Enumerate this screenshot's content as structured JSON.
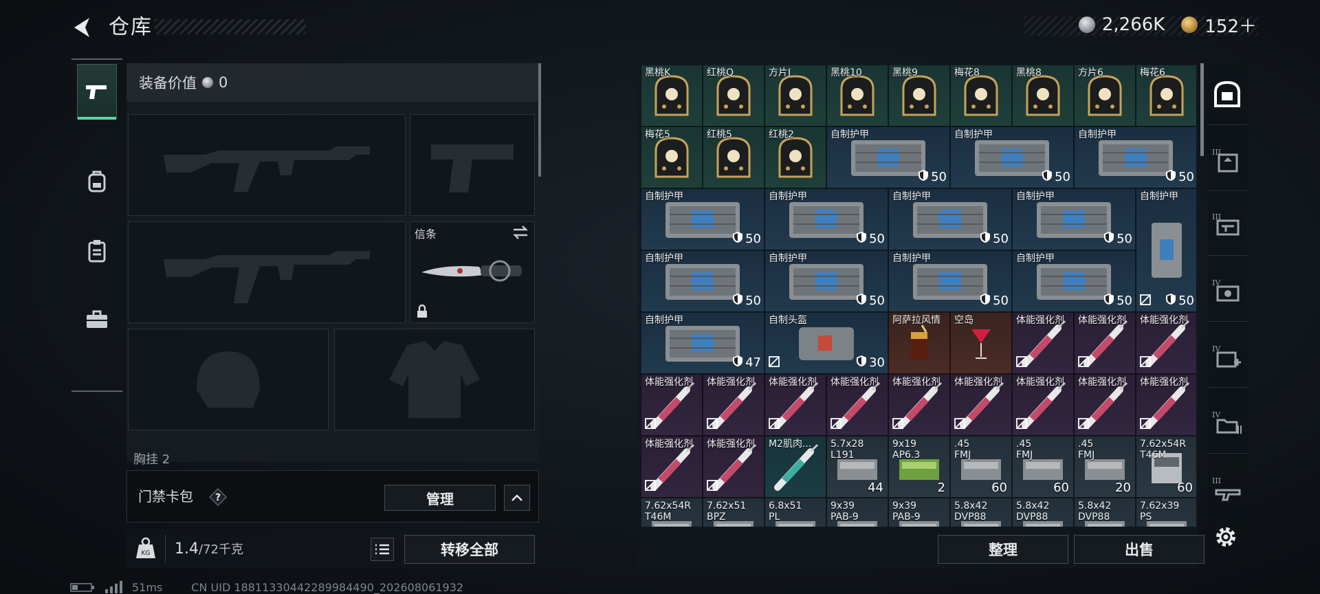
{
  "header": {
    "title": "仓库",
    "currency": [
      {
        "icon": "silver-coin-icon",
        "value": "2,266K"
      },
      {
        "icon": "gold-coin-icon",
        "value": "152＋"
      }
    ]
  },
  "left_tabs": [
    {
      "icon": "pistol-icon",
      "active": true
    },
    {
      "icon": "backpack-icon",
      "active": false
    },
    {
      "icon": "clipboard-icon",
      "active": false
    },
    {
      "icon": "briefcase-icon",
      "active": false
    }
  ],
  "equipment": {
    "label": "装备价值",
    "value": "0",
    "knife_slot_label": "信条",
    "chest_label": "胸挂",
    "chest_value": "2"
  },
  "access_card": {
    "label": "门禁卡包",
    "help": "?",
    "manage": "管理"
  },
  "weight": {
    "current": "1.4",
    "max": "/72千克"
  },
  "buttons": {
    "transfer_all": "转移全部",
    "sort": "整理",
    "sell": "出售"
  },
  "status": {
    "ping": "51ms",
    "uid": "CN UID 18811330442289984490_202608061932"
  },
  "inventory": [
    {
      "row": 0,
      "col": 0,
      "name": "黑桃K",
      "type": "card"
    },
    {
      "row": 0,
      "col": 1,
      "name": "红桃Q",
      "type": "card"
    },
    {
      "row": 0,
      "col": 2,
      "name": "方片J",
      "type": "card"
    },
    {
      "row": 0,
      "col": 3,
      "name": "黑桃10",
      "type": "card"
    },
    {
      "row": 0,
      "col": 4,
      "name": "黑桃9",
      "type": "card"
    },
    {
      "row": 0,
      "col": 5,
      "name": "梅花8",
      "type": "card"
    },
    {
      "row": 0,
      "col": 6,
      "name": "黑桃8",
      "type": "card"
    },
    {
      "row": 0,
      "col": 7,
      "name": "方片6",
      "type": "card"
    },
    {
      "row": 0,
      "col": 8,
      "name": "梅花6",
      "type": "card"
    },
    {
      "row": 1,
      "col": 0,
      "name": "梅花5",
      "type": "card"
    },
    {
      "row": 1,
      "col": 1,
      "name": "红桃5",
      "type": "card"
    },
    {
      "row": 1,
      "col": 2,
      "name": "红桃2",
      "type": "card"
    },
    {
      "row": 1,
      "col": 3,
      "w": 2,
      "name": "自制护甲",
      "type": "armor",
      "dur": "50"
    },
    {
      "row": 1,
      "col": 5,
      "w": 2,
      "name": "自制护甲",
      "type": "armor",
      "dur": "50"
    },
    {
      "row": 1,
      "col": 7,
      "w": 2,
      "name": "自制护甲",
      "type": "armor",
      "dur": "50"
    },
    {
      "row": 2,
      "col": 0,
      "w": 2,
      "name": "自制护甲",
      "type": "armor",
      "dur": "50"
    },
    {
      "row": 2,
      "col": 2,
      "w": 2,
      "name": "自制护甲",
      "type": "armor",
      "dur": "50"
    },
    {
      "row": 2,
      "col": 4,
      "w": 2,
      "name": "自制护甲",
      "type": "armor",
      "dur": "50"
    },
    {
      "row": 2,
      "col": 6,
      "w": 2,
      "name": "自制护甲",
      "type": "armor",
      "dur": "50"
    },
    {
      "row": 2,
      "col": 8,
      "h": 2,
      "name": "自制护甲",
      "type": "armor-v",
      "dur": "50",
      "unlocked": true
    },
    {
      "row": 3,
      "col": 0,
      "w": 2,
      "name": "自制护甲",
      "type": "armor",
      "dur": "50"
    },
    {
      "row": 3,
      "col": 2,
      "w": 2,
      "name": "自制护甲",
      "type": "armor",
      "dur": "50"
    },
    {
      "row": 3,
      "col": 4,
      "w": 2,
      "name": "自制护甲",
      "type": "armor",
      "dur": "50"
    },
    {
      "row": 3,
      "col": 6,
      "w": 2,
      "name": "自制护甲",
      "type": "armor",
      "dur": "50"
    },
    {
      "row": 4,
      "col": 0,
      "w": 2,
      "name": "自制护甲",
      "type": "armor",
      "dur": "47"
    },
    {
      "row": 4,
      "col": 2,
      "w": 2,
      "name": "自制头盔",
      "type": "helmet",
      "dur": "30",
      "unlocked": true
    },
    {
      "row": 4,
      "col": 4,
      "name": "阿萨拉风情",
      "type": "drink"
    },
    {
      "row": 4,
      "col": 5,
      "name": "空岛",
      "type": "cocktail"
    },
    {
      "row": 4,
      "col": 6,
      "name": "体能强化剂",
      "type": "syringe",
      "unlocked": true
    },
    {
      "row": 4,
      "col": 7,
      "name": "体能强化剂",
      "type": "syringe",
      "unlocked": true
    },
    {
      "row": 4,
      "col": 8,
      "name": "体能强化剂",
      "type": "syringe",
      "unlocked": true
    },
    {
      "row": 5,
      "col": 0,
      "name": "体能强化剂",
      "type": "syringe",
      "unlocked": true
    },
    {
      "row": 5,
      "col": 1,
      "name": "体能强化剂",
      "type": "syringe",
      "unlocked": true
    },
    {
      "row": 5,
      "col": 2,
      "name": "体能强化剂",
      "type": "syringe",
      "unlocked": true
    },
    {
      "row": 5,
      "col": 3,
      "name": "体能强化剂",
      "type": "syringe",
      "unlocked": true
    },
    {
      "row": 5,
      "col": 4,
      "name": "体能强化剂",
      "type": "syringe",
      "unlocked": true
    },
    {
      "row": 5,
      "col": 5,
      "name": "体能强化剂",
      "type": "syringe",
      "unlocked": true
    },
    {
      "row": 5,
      "col": 6,
      "name": "体能强化剂",
      "type": "syringe",
      "unlocked": true
    },
    {
      "row": 5,
      "col": 7,
      "name": "体能强化剂",
      "type": "syringe",
      "unlocked": true
    },
    {
      "row": 5,
      "col": 8,
      "name": "体能强化剂",
      "type": "syringe",
      "unlocked": true
    },
    {
      "row": 6,
      "col": 0,
      "name": "体能强化剂",
      "type": "syringe",
      "unlocked": true
    },
    {
      "row": 6,
      "col": 1,
      "name": "体能强化剂",
      "type": "syringe",
      "unlocked": true
    },
    {
      "row": 6,
      "col": 2,
      "name": "M2肌肉...",
      "type": "syringe-teal"
    },
    {
      "row": 6,
      "col": 3,
      "name": "5.7x28",
      "name2": "L191",
      "type": "ammo",
      "count": "44"
    },
    {
      "row": 6,
      "col": 4,
      "name": "9x19",
      "name2": "AP6.3",
      "type": "ammo-green",
      "count": "2"
    },
    {
      "row": 6,
      "col": 5,
      "name": ".45",
      "name2": "FMJ",
      "type": "ammo",
      "count": "60"
    },
    {
      "row": 6,
      "col": 6,
      "name": ".45",
      "name2": "FMJ",
      "type": "ammo",
      "count": "60"
    },
    {
      "row": 6,
      "col": 7,
      "name": ".45",
      "name2": "FMJ",
      "type": "ammo",
      "count": "20"
    },
    {
      "row": 6,
      "col": 8,
      "name": "7.62x54R",
      "name2": "T46M",
      "type": "ammo-box",
      "count": "60"
    },
    {
      "row": 7,
      "col": 0,
      "name": "7.62x54R",
      "name2": "T46M",
      "type": "ammo"
    },
    {
      "row": 7,
      "col": 1,
      "name": "7.62x51",
      "name2": "BPZ",
      "type": "ammo"
    },
    {
      "row": 7,
      "col": 2,
      "name": "6.8x51",
      "name2": "PL",
      "type": "ammo"
    },
    {
      "row": 7,
      "col": 3,
      "name": "9x39",
      "name2": "PAB-9",
      "type": "ammo"
    },
    {
      "row": 7,
      "col": 4,
      "name": "9x39",
      "name2": "PAB-9",
      "type": "ammo"
    },
    {
      "row": 7,
      "col": 5,
      "name": "5.8x42",
      "name2": "DVP88",
      "type": "ammo"
    },
    {
      "row": 7,
      "col": 6,
      "name": "5.8x42",
      "name2": "DVP88",
      "type": "ammo"
    },
    {
      "row": 7,
      "col": 7,
      "name": "5.8x42",
      "name2": "DVP88",
      "type": "ammo"
    },
    {
      "row": 7,
      "col": 8,
      "name": "7.62x39",
      "name2": "PS",
      "type": "ammo"
    }
  ],
  "right_rail": [
    {
      "icon": "safe-box-icon"
    },
    {
      "icon": "tier3-backpack-icon",
      "tier": "III"
    },
    {
      "icon": "tier3-gun-icon",
      "tier": "III"
    },
    {
      "icon": "tier4-camera-icon",
      "tier": "IV"
    },
    {
      "icon": "tier4-medkit-icon",
      "tier": "IV"
    },
    {
      "icon": "tier4-folder-icon",
      "tier": "IV"
    },
    {
      "icon": "tier3-rifle-icon",
      "tier": "III"
    }
  ],
  "colors": {
    "accent": "#5fd3a8",
    "panel": "#12181e",
    "button_border": "#454c53"
  }
}
